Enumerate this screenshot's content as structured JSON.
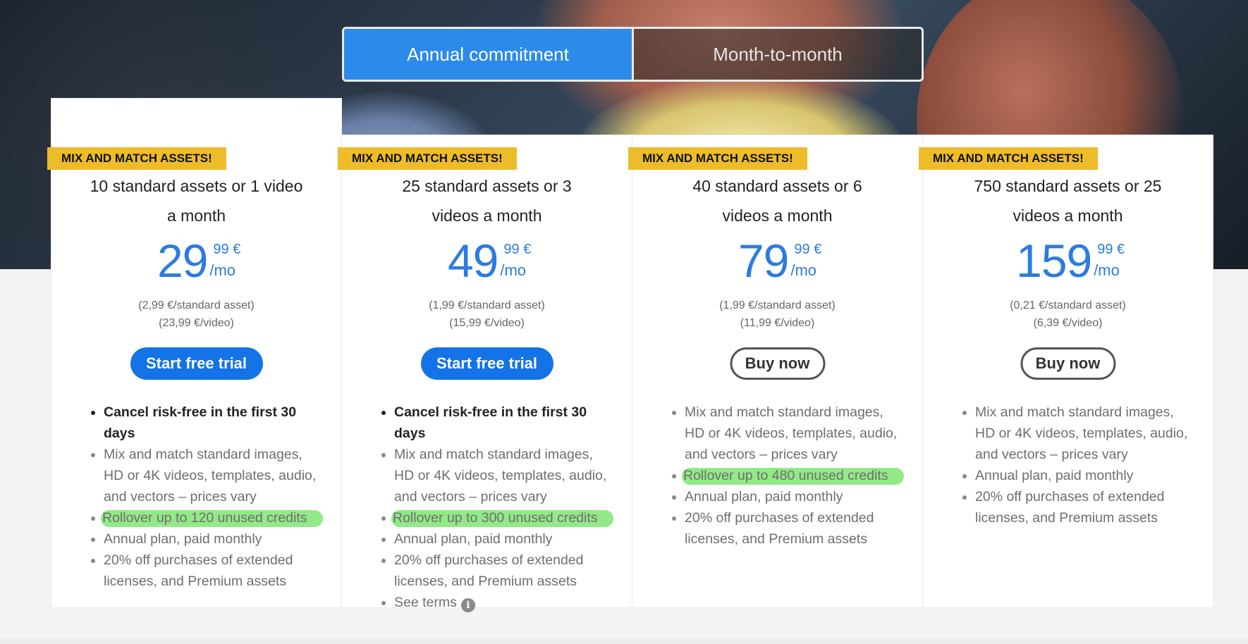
{
  "toggle": {
    "annual": "Annual commitment",
    "monthly": "Month-to-month"
  },
  "colors": {
    "accent_blue": "#1473e6",
    "price_blue": "#2c7be0",
    "badge_yellow": "#eebb2a",
    "highlight_green": "#6ee15f"
  },
  "plans": [
    {
      "badge": "MIX AND MATCH ASSETS!",
      "title_line1": "10 standard assets or 1 video",
      "title_line2": "a month",
      "price": "29",
      "cents": "99 €",
      "per": "/mo",
      "sub1": "(2,99 €/standard asset)",
      "sub2": "(23,99 €/video)",
      "button": "Start free trial",
      "features": [
        "Cancel risk-free in the first 30 days",
        "Mix and match standard images, HD or 4K videos, templates, audio, and vectors – prices vary",
        "Rollover up to 120 unused credits",
        "Annual plan, paid monthly",
        "20% off purchases of extended licenses, and Premium assets"
      ]
    },
    {
      "badge": "MIX AND MATCH ASSETS!",
      "title_line1": "25 standard assets or 3",
      "title_line2": "videos a month",
      "price": "49",
      "cents": "99 €",
      "per": "/mo",
      "sub1": "(1,99 €/standard asset)",
      "sub2": "(15,99 €/video)",
      "button": "Start free trial",
      "features": [
        "Cancel risk-free in the first 30 days",
        "Mix and match standard images, HD or 4K videos, templates, audio, and vectors – prices vary",
        "Rollover up to 300 unused credits",
        "Annual plan, paid monthly",
        "20% off purchases of extended licenses, and Premium assets",
        "See terms"
      ]
    },
    {
      "badge": "MIX AND MATCH ASSETS!",
      "title_line1": "40 standard assets or 6",
      "title_line2": "videos a month",
      "price": "79",
      "cents": "99 €",
      "per": "/mo",
      "sub1": "(1,99 €/standard asset)",
      "sub2": "(11,99 €/video)",
      "button": "Buy now",
      "features": [
        "Mix and match standard images, HD or 4K videos, templates, audio, and vectors – prices vary",
        "Rollover up to 480 unused credits",
        "Annual plan, paid monthly",
        "20% off purchases of extended licenses, and Premium assets"
      ]
    },
    {
      "badge": "MIX AND MATCH ASSETS!",
      "title_line1": "750 standard assets or 25",
      "title_line2": "videos a month",
      "price": "159",
      "cents": "99 €",
      "per": "/mo",
      "sub1": "(0,21 €/standard asset)",
      "sub2": "(6,39 €/video)",
      "button": "Buy now",
      "features": [
        "Mix and match standard images, HD or 4K videos, templates, audio, and vectors – prices vary",
        "Annual plan, paid monthly",
        "20% off purchases of extended licenses, and Premium assets"
      ]
    }
  ]
}
